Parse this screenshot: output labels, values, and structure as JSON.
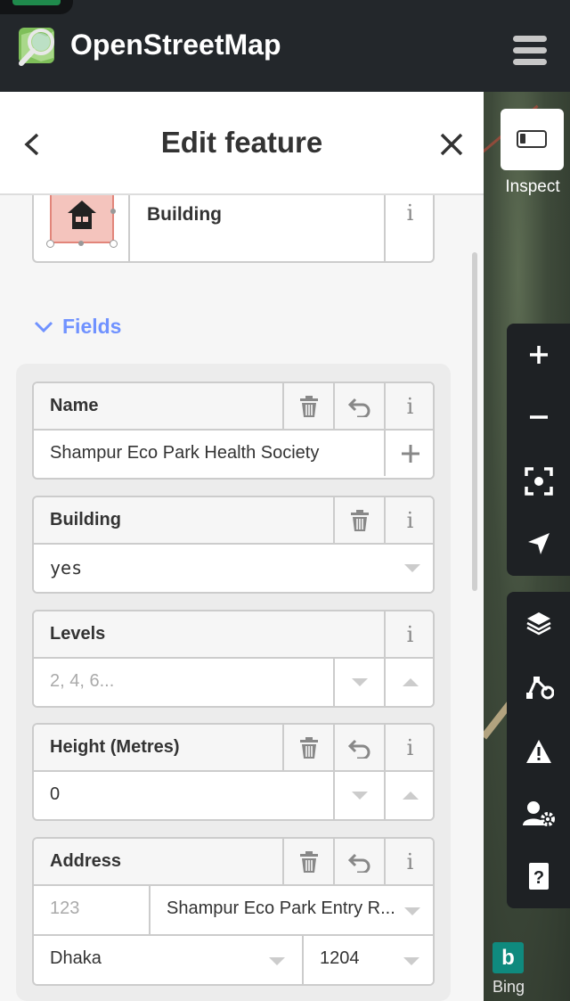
{
  "app": {
    "brand": "OpenStreetMap"
  },
  "panel": {
    "title": "Edit feature",
    "preset": {
      "name": "Building",
      "icon": "house-icon"
    },
    "fields_label": "Fields",
    "fields": {
      "name": {
        "label": "Name",
        "value": "Shampur Eco Park Health Society"
      },
      "building": {
        "label": "Building",
        "value": "yes"
      },
      "levels": {
        "label": "Levels",
        "placeholder": "2, 4, 6..."
      },
      "height": {
        "label": "Height (Metres)",
        "value": "0"
      },
      "address": {
        "label": "Address",
        "housenumber_placeholder": "123",
        "street": "Shampur Eco Park Entry R...",
        "city": "Dhaka",
        "postcode": "1204"
      }
    }
  },
  "map": {
    "inspect_label": "Inspect",
    "imagery": "Bing",
    "bing_logo": "b"
  },
  "colors": {
    "accent": "#7092ff",
    "topbar": "#23272b",
    "building_fill": "#f4c4bd"
  }
}
